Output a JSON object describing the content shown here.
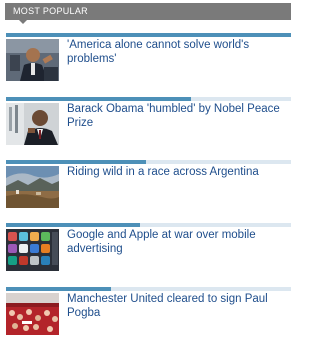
{
  "header": {
    "title": "MOST POPULAR"
  },
  "stories": [
    {
      "headline": "'America alone cannot solve world's problems'",
      "thumbnail_icon": "speaker-at-podium-photo",
      "popularity": 1.0
    },
    {
      "headline": "Barack Obama 'humbled' by Nobel Peace Prize",
      "thumbnail_icon": "obama-portrait-photo",
      "popularity": 0.65
    },
    {
      "headline": "Riding wild in a race across Argentina",
      "thumbnail_icon": "landscape-photo",
      "popularity": 0.49
    },
    {
      "headline": "Google and Apple at war over mobile advertising",
      "thumbnail_icon": "app-icons-collage-photo",
      "popularity": 0.47
    },
    {
      "headline": "Manchester United cleared to sign Paul Pogba",
      "thumbnail_icon": "football-crowd-photo",
      "popularity": 0.37
    }
  ],
  "colors": {
    "header_bg": "#7a7a7a",
    "bar_fill": "#4d90b8",
    "bar_track": "#dce7f0",
    "link": "#1f4e8c"
  }
}
